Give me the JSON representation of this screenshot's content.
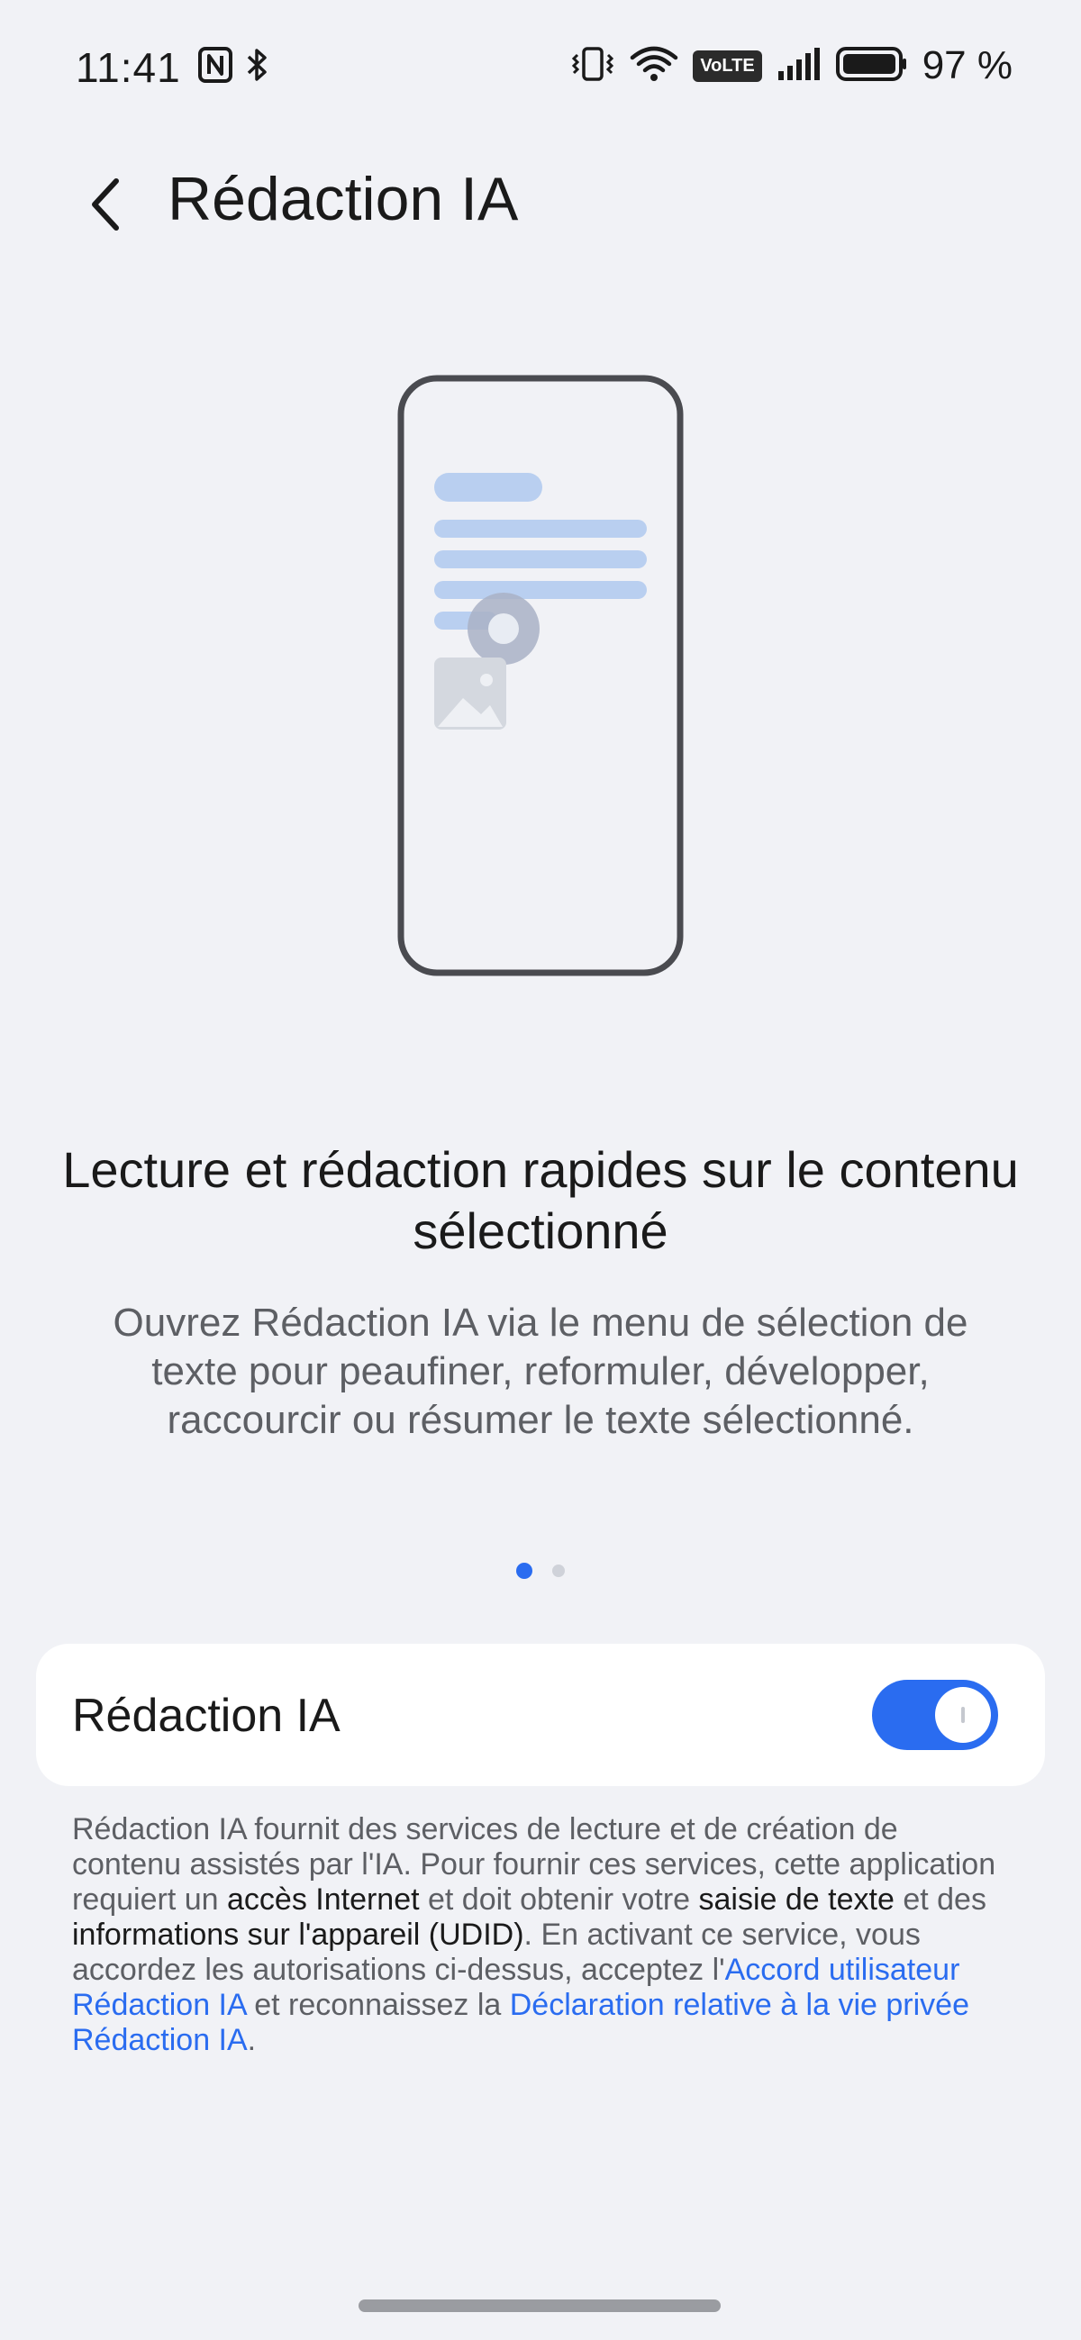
{
  "status_bar": {
    "time": "11:41",
    "battery_percent": "97 %",
    "volte_label": "VoLTE",
    "icons": [
      "nfc-icon",
      "bluetooth-icon",
      "vibrate-icon",
      "wifi-icon",
      "volte-icon",
      "signal-icon",
      "battery-icon"
    ]
  },
  "header": {
    "title": "Rédaction IA",
    "back_icon": "chevron-left-icon"
  },
  "illustration": {
    "icons": [
      "phone-outline-icon",
      "text-lines-icon",
      "cursor-icon",
      "image-icon"
    ],
    "colors": {
      "phone_outline": "#4a4b50",
      "text_bars": "#b9cff0",
      "overlay": "#a9b2c5"
    }
  },
  "feature": {
    "title_line1": "Lecture et rédaction rapides sur le contenu",
    "title_line2": "sélectionné",
    "description": "Ouvrez Rédaction IA via le menu de sélection de texte pour peaufiner, reformuler, développer, raccourcir ou résumer le texte sélectionné."
  },
  "pager": {
    "page_count": 2,
    "active_index": 0
  },
  "toggle_card": {
    "label": "Rédaction IA",
    "enabled": true
  },
  "legal": {
    "part1": "Rédaction IA fournit des services de lecture et de création de contenu assistés par l'IA. Pour fournir ces services, cette application requiert un ",
    "bold1": "accès Internet",
    "part2": " et doit obtenir votre ",
    "bold2": "saisie de texte",
    "part3": " et des ",
    "bold3": "informations sur l'appareil (UDID)",
    "part4": ". En activant ce service, vous accordez les autorisations ci-dessus, acceptez l'",
    "link1": "Accord utilisateur Rédaction IA",
    "part5": " et reconnaissez la ",
    "link2": "Déclaration relative à la vie privée Rédaction IA",
    "part6": "."
  },
  "colors": {
    "background": "#f1f2f6",
    "accent": "#2a6cf0",
    "card": "#ffffff",
    "secondary_text": "#5d5f64"
  }
}
